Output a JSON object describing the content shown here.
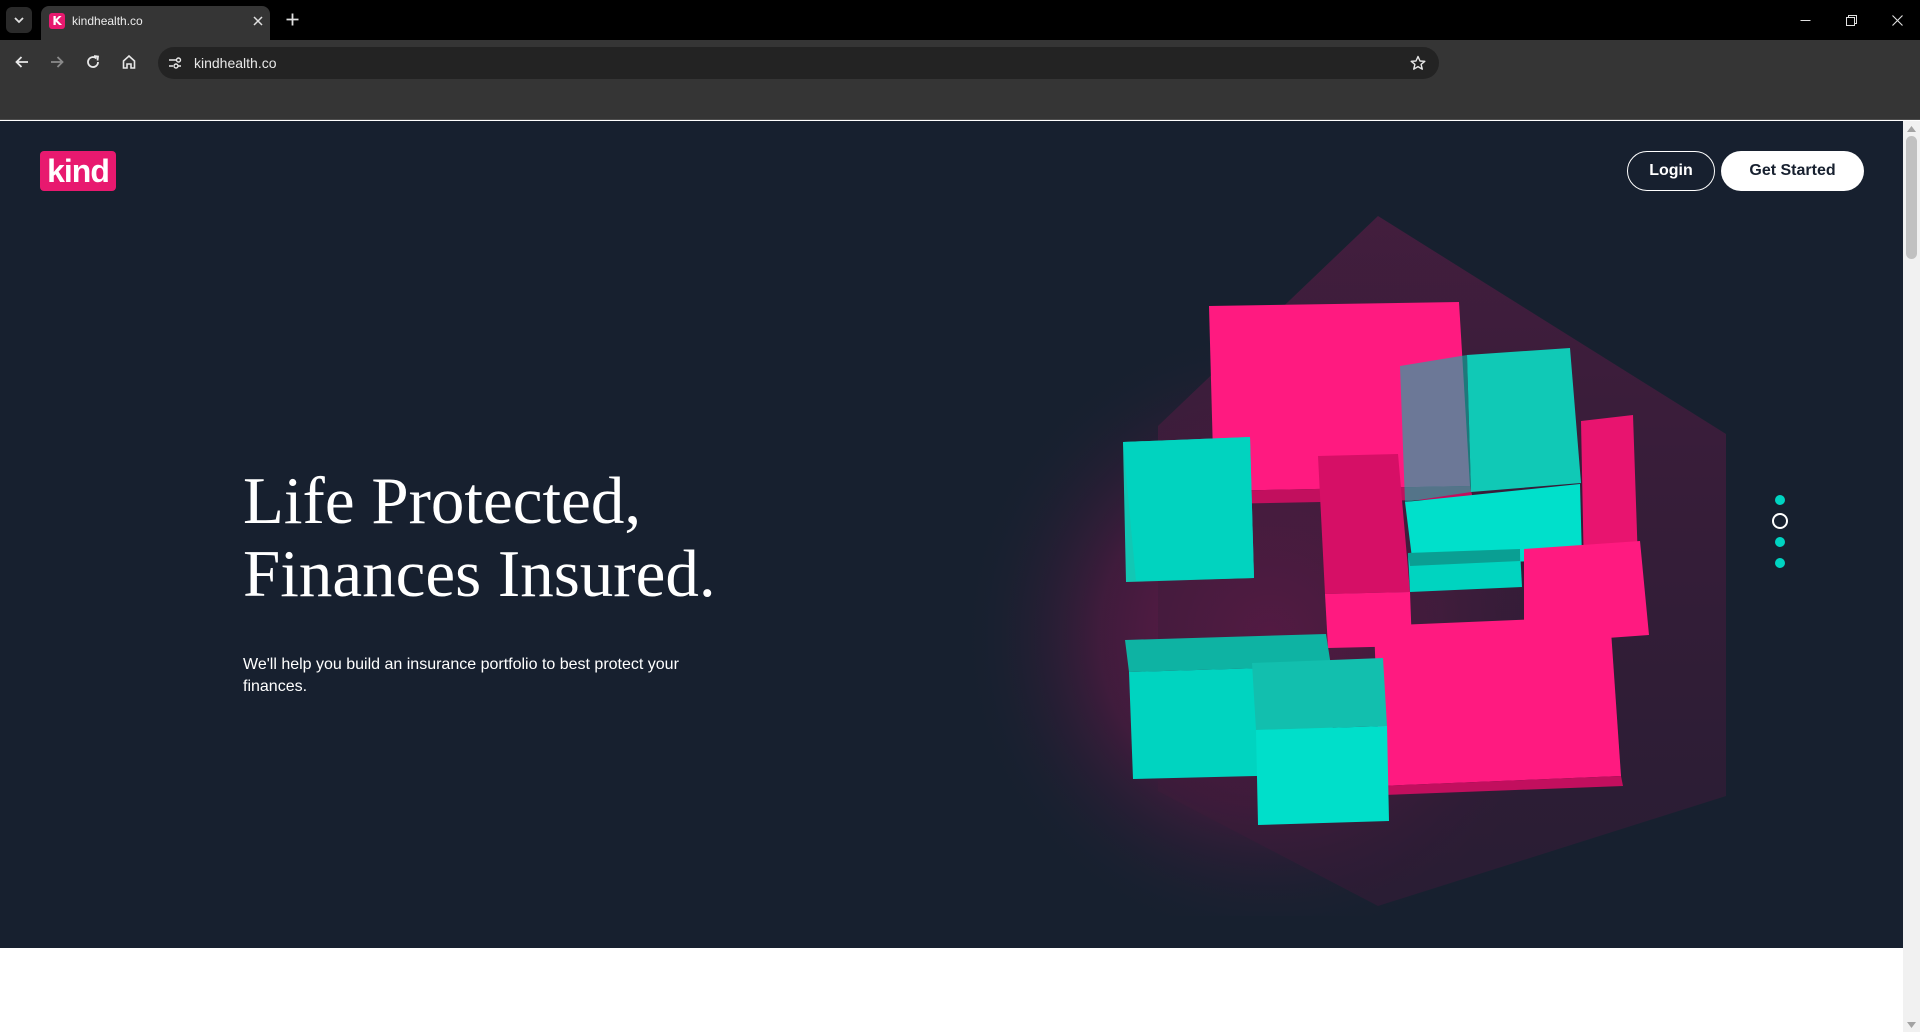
{
  "browser": {
    "tab_title": "kindhealth.co",
    "favicon_letter": "K",
    "url": "kindhealth.co"
  },
  "site": {
    "logo_text": "kind",
    "nav": {
      "login_label": "Login",
      "get_started_label": "Get Started"
    },
    "hero": {
      "headline_line1": "Life Protected,",
      "headline_line2": "Finances Insured.",
      "subtext": "We'll help you build an insurance portfolio to best protect your finances."
    },
    "carousel": {
      "slide_count": 4,
      "active_slide": 2
    }
  },
  "colors": {
    "brand_pink": "#e8196f",
    "accent_teal": "#00d4c2",
    "hero_background": "#17202f"
  },
  "icons": [
    "tab-list-icon",
    "favicon-icon",
    "tab-close-icon",
    "new-tab-icon",
    "minimize-icon",
    "restore-icon",
    "close-window-icon",
    "back-icon",
    "forward-icon",
    "reload-icon",
    "home-icon",
    "site-info-icon",
    "bookmark-star-icon"
  ]
}
